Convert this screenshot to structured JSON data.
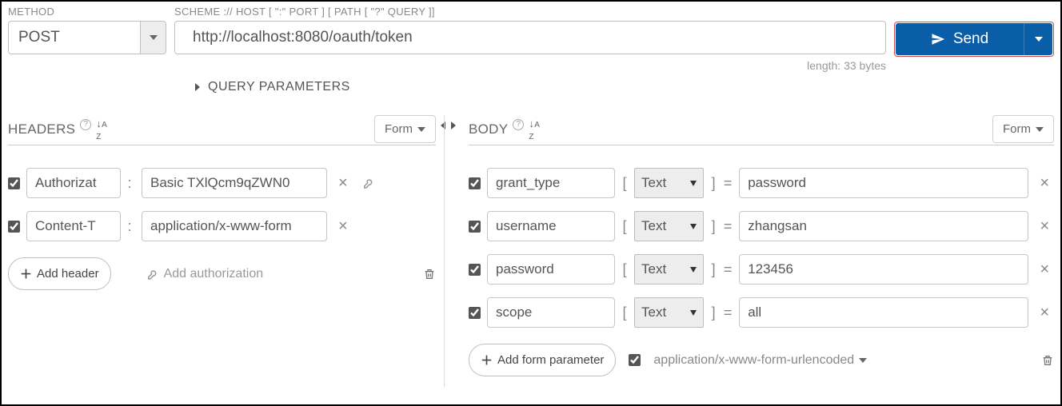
{
  "top": {
    "method_label": "METHOD",
    "method_value": "POST",
    "url_label": "SCHEME :// HOST [ \":\" PORT ] [ PATH [ \"?\" QUERY ]]",
    "url_value": "http://localhost:8080/oauth/token",
    "send_label": "Send",
    "length_info": "length: 33 bytes",
    "query_params_label": "QUERY PARAMETERS"
  },
  "headers": {
    "title": "HEADERS",
    "view_mode": "Form",
    "rows": [
      {
        "name": "Authorizat",
        "value": "Basic TXlQcm9qZWN0",
        "show_key": true
      },
      {
        "name": "Content-T",
        "value": "application/x-www-form",
        "show_key": false
      }
    ],
    "add_label": "Add header",
    "add_auth_label": "Add authorization"
  },
  "body": {
    "title": "BODY",
    "view_mode": "Form",
    "rows": [
      {
        "name": "grant_type",
        "type": "Text",
        "value": "password"
      },
      {
        "name": "username",
        "type": "Text",
        "value": "zhangsan"
      },
      {
        "name": "password",
        "type": "Text",
        "value": "123456"
      },
      {
        "name": "scope",
        "type": "Text",
        "value": "all"
      }
    ],
    "add_label": "Add form parameter",
    "content_type": "application/x-www-form-urlencoded"
  }
}
